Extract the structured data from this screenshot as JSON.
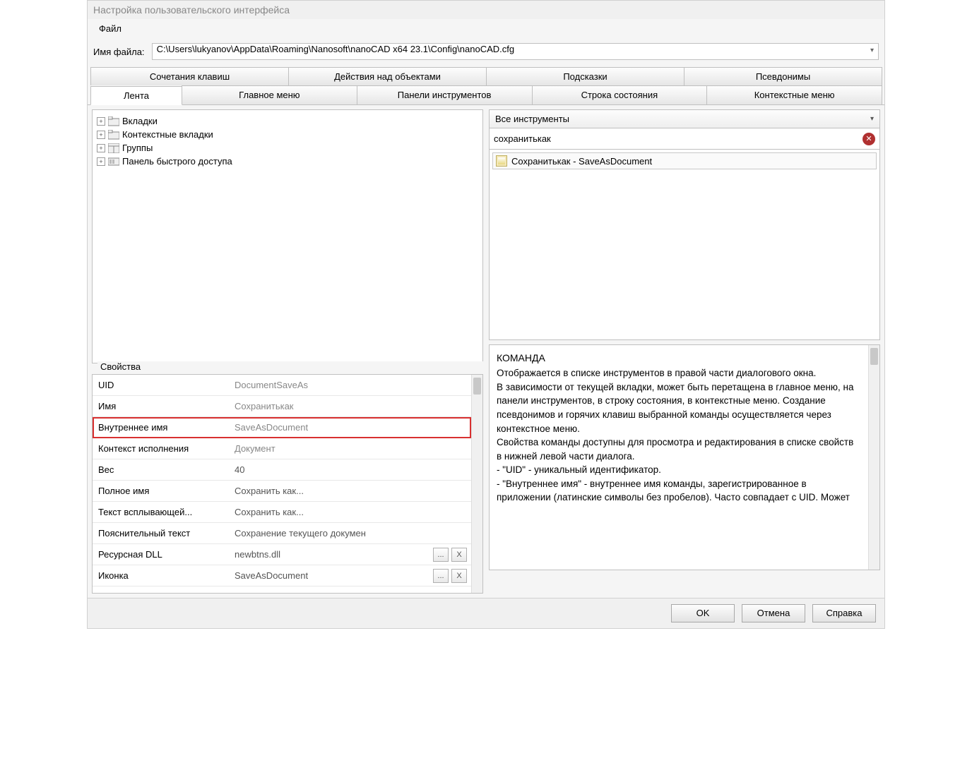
{
  "window": {
    "title": "Настройка пользовательского интерфейса"
  },
  "menu": {
    "file": "Файл"
  },
  "file_row": {
    "label": "Имя файла:",
    "path": "C:\\Users\\lukyanov\\AppData\\Roaming\\Nanosoft\\nanoCAD x64 23.1\\Config\\nanoCAD.cfg"
  },
  "tabs_top": [
    "Сочетания клавиш",
    "Действия над объектами",
    "Подсказки",
    "Псевдонимы"
  ],
  "tabs_bottom": [
    "Лента",
    "Главное меню",
    "Панели инструментов",
    "Строка состояния",
    "Контекстные меню"
  ],
  "active_tab": "Лента",
  "tree": [
    "Вкладки",
    "Контекстные вкладки",
    "Группы",
    "Панель быстрого доступа"
  ],
  "tools_combo": "Все инструменты",
  "search": {
    "value": "сохранитькак"
  },
  "result": {
    "label": "Сохранитькак - SaveAsDocument"
  },
  "props": {
    "title": "Свойства",
    "rows": [
      {
        "label": "UID",
        "value": "DocumentSaveAs",
        "readonly": true
      },
      {
        "label": "Имя",
        "value": "Сохранитькак",
        "readonly": true
      },
      {
        "label": "Внутреннее имя",
        "value": "SaveAsDocument",
        "readonly": true,
        "highlight": true
      },
      {
        "label": "Контекст исполнения",
        "value": "Документ",
        "readonly": true
      },
      {
        "label": "Вес",
        "value": "40"
      },
      {
        "label": "Полное имя",
        "value": "Сохранить как..."
      },
      {
        "label": "Текст всплывающей...",
        "value": "Сохранить как..."
      },
      {
        "label": "Пояснительный текст",
        "value": "Сохранение текущего докумен"
      },
      {
        "label": "Ресурсная DLL",
        "value": "newbtns.dll",
        "buttons": true
      },
      {
        "label": "Иконка",
        "value": "SaveAsDocument",
        "buttons": true
      }
    ]
  },
  "help": {
    "heading": "КОМАНДА",
    "p1": "Отображается в списке инструментов в правой части диалогового окна.",
    "p2": "В зависимости от текущей вкладки, может быть перетащена в главное меню, на панели инструментов, в строку состояния, в контекстные меню. Создание псевдонимов и горячих клавиш выбранной команды осуществляется через контекстное меню.",
    "p3": "Свойства команды доступны для просмотра и редактирования в списке свойств в нижней левой части диалога.",
    "b1": " - \"UID\" - уникальный идентификатор.",
    "b2": " - \"Внутреннее имя\" - внутреннее имя команды, зарегистрированное в приложении (латинские символы без пробелов). Часто совпадает с UID. Может"
  },
  "buttons": {
    "ok": "OK",
    "cancel": "Отмена",
    "help": "Справка"
  },
  "btn_ellipsis": "...",
  "btn_x": "X"
}
